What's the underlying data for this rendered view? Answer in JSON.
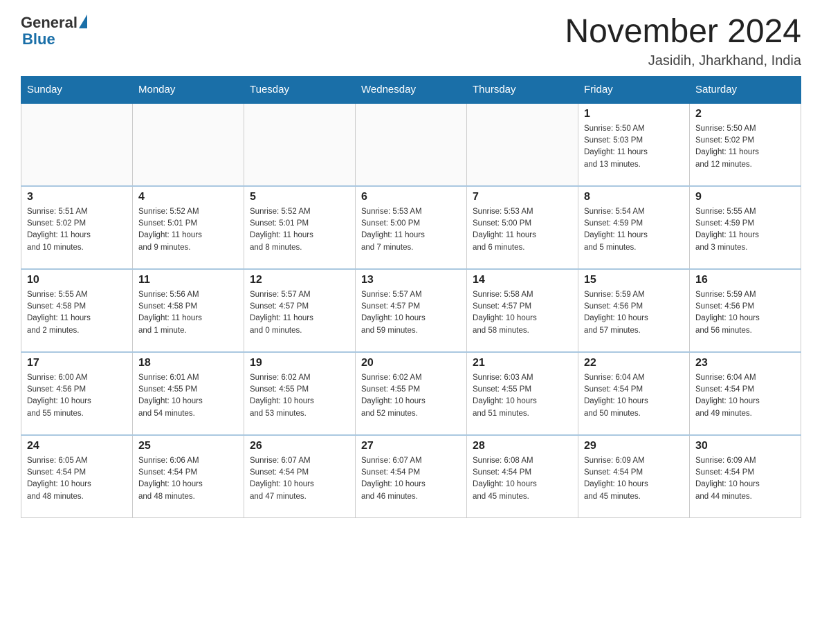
{
  "header": {
    "logo_general": "General",
    "logo_blue": "Blue",
    "month_title": "November 2024",
    "location": "Jasidih, Jharkhand, India"
  },
  "days_of_week": [
    "Sunday",
    "Monday",
    "Tuesday",
    "Wednesday",
    "Thursday",
    "Friday",
    "Saturday"
  ],
  "weeks": [
    [
      {
        "day": "",
        "info": ""
      },
      {
        "day": "",
        "info": ""
      },
      {
        "day": "",
        "info": ""
      },
      {
        "day": "",
        "info": ""
      },
      {
        "day": "",
        "info": ""
      },
      {
        "day": "1",
        "info": "Sunrise: 5:50 AM\nSunset: 5:03 PM\nDaylight: 11 hours\nand 13 minutes."
      },
      {
        "day": "2",
        "info": "Sunrise: 5:50 AM\nSunset: 5:02 PM\nDaylight: 11 hours\nand 12 minutes."
      }
    ],
    [
      {
        "day": "3",
        "info": "Sunrise: 5:51 AM\nSunset: 5:02 PM\nDaylight: 11 hours\nand 10 minutes."
      },
      {
        "day": "4",
        "info": "Sunrise: 5:52 AM\nSunset: 5:01 PM\nDaylight: 11 hours\nand 9 minutes."
      },
      {
        "day": "5",
        "info": "Sunrise: 5:52 AM\nSunset: 5:01 PM\nDaylight: 11 hours\nand 8 minutes."
      },
      {
        "day": "6",
        "info": "Sunrise: 5:53 AM\nSunset: 5:00 PM\nDaylight: 11 hours\nand 7 minutes."
      },
      {
        "day": "7",
        "info": "Sunrise: 5:53 AM\nSunset: 5:00 PM\nDaylight: 11 hours\nand 6 minutes."
      },
      {
        "day": "8",
        "info": "Sunrise: 5:54 AM\nSunset: 4:59 PM\nDaylight: 11 hours\nand 5 minutes."
      },
      {
        "day": "9",
        "info": "Sunrise: 5:55 AM\nSunset: 4:59 PM\nDaylight: 11 hours\nand 3 minutes."
      }
    ],
    [
      {
        "day": "10",
        "info": "Sunrise: 5:55 AM\nSunset: 4:58 PM\nDaylight: 11 hours\nand 2 minutes."
      },
      {
        "day": "11",
        "info": "Sunrise: 5:56 AM\nSunset: 4:58 PM\nDaylight: 11 hours\nand 1 minute."
      },
      {
        "day": "12",
        "info": "Sunrise: 5:57 AM\nSunset: 4:57 PM\nDaylight: 11 hours\nand 0 minutes."
      },
      {
        "day": "13",
        "info": "Sunrise: 5:57 AM\nSunset: 4:57 PM\nDaylight: 10 hours\nand 59 minutes."
      },
      {
        "day": "14",
        "info": "Sunrise: 5:58 AM\nSunset: 4:57 PM\nDaylight: 10 hours\nand 58 minutes."
      },
      {
        "day": "15",
        "info": "Sunrise: 5:59 AM\nSunset: 4:56 PM\nDaylight: 10 hours\nand 57 minutes."
      },
      {
        "day": "16",
        "info": "Sunrise: 5:59 AM\nSunset: 4:56 PM\nDaylight: 10 hours\nand 56 minutes."
      }
    ],
    [
      {
        "day": "17",
        "info": "Sunrise: 6:00 AM\nSunset: 4:56 PM\nDaylight: 10 hours\nand 55 minutes."
      },
      {
        "day": "18",
        "info": "Sunrise: 6:01 AM\nSunset: 4:55 PM\nDaylight: 10 hours\nand 54 minutes."
      },
      {
        "day": "19",
        "info": "Sunrise: 6:02 AM\nSunset: 4:55 PM\nDaylight: 10 hours\nand 53 minutes."
      },
      {
        "day": "20",
        "info": "Sunrise: 6:02 AM\nSunset: 4:55 PM\nDaylight: 10 hours\nand 52 minutes."
      },
      {
        "day": "21",
        "info": "Sunrise: 6:03 AM\nSunset: 4:55 PM\nDaylight: 10 hours\nand 51 minutes."
      },
      {
        "day": "22",
        "info": "Sunrise: 6:04 AM\nSunset: 4:54 PM\nDaylight: 10 hours\nand 50 minutes."
      },
      {
        "day": "23",
        "info": "Sunrise: 6:04 AM\nSunset: 4:54 PM\nDaylight: 10 hours\nand 49 minutes."
      }
    ],
    [
      {
        "day": "24",
        "info": "Sunrise: 6:05 AM\nSunset: 4:54 PM\nDaylight: 10 hours\nand 48 minutes."
      },
      {
        "day": "25",
        "info": "Sunrise: 6:06 AM\nSunset: 4:54 PM\nDaylight: 10 hours\nand 48 minutes."
      },
      {
        "day": "26",
        "info": "Sunrise: 6:07 AM\nSunset: 4:54 PM\nDaylight: 10 hours\nand 47 minutes."
      },
      {
        "day": "27",
        "info": "Sunrise: 6:07 AM\nSunset: 4:54 PM\nDaylight: 10 hours\nand 46 minutes."
      },
      {
        "day": "28",
        "info": "Sunrise: 6:08 AM\nSunset: 4:54 PM\nDaylight: 10 hours\nand 45 minutes."
      },
      {
        "day": "29",
        "info": "Sunrise: 6:09 AM\nSunset: 4:54 PM\nDaylight: 10 hours\nand 45 minutes."
      },
      {
        "day": "30",
        "info": "Sunrise: 6:09 AM\nSunset: 4:54 PM\nDaylight: 10 hours\nand 44 minutes."
      }
    ]
  ]
}
